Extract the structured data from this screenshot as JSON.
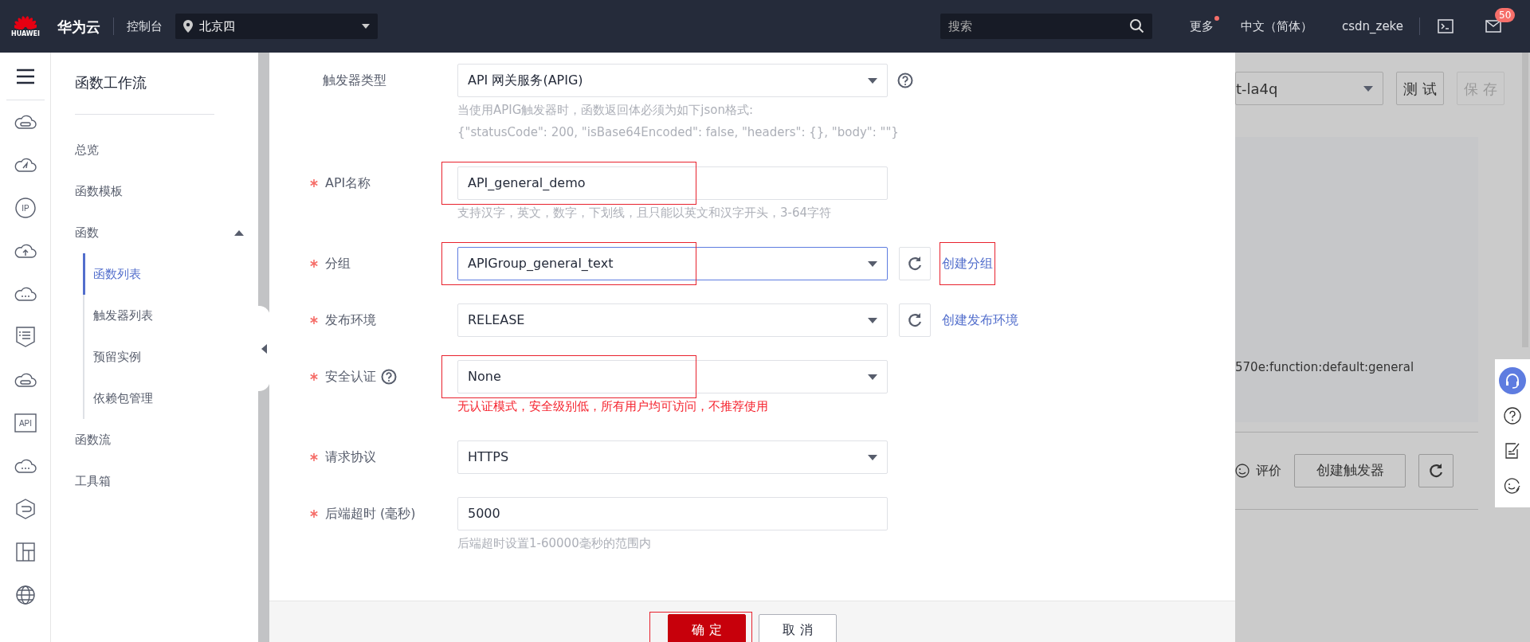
{
  "topbar": {
    "logo_caption": "HUAWEI",
    "brand": "华为云",
    "console": "控制台",
    "region": "北京四",
    "search_placeholder": "搜索",
    "more": "更多",
    "more_notice": true,
    "language": "中文（简体）",
    "user": "csdn_zeke",
    "mail_badge": "50"
  },
  "rail": [
    {
      "kind": "menu"
    },
    {
      "kind": "cloud-disk"
    },
    {
      "kind": "cloud-check"
    },
    {
      "kind": "ip",
      "label": "IP"
    },
    {
      "kind": "cloud-upload"
    },
    {
      "kind": "cloud-dots"
    },
    {
      "kind": "list-shield"
    },
    {
      "kind": "cloud-disk"
    },
    {
      "kind": "api",
      "label": "API"
    },
    {
      "kind": "cloud-dots"
    },
    {
      "kind": "hexagon"
    },
    {
      "kind": "layout"
    },
    {
      "kind": "globe"
    }
  ],
  "sidebar": {
    "title": "函数工作流",
    "items": [
      {
        "label": "总览",
        "selected": false
      },
      {
        "label": "函数模板",
        "selected": false
      },
      {
        "label": "函数",
        "selected": false,
        "expanded": true,
        "children": [
          {
            "label": "函数列表",
            "selected": true
          },
          {
            "label": "触发器列表",
            "selected": false
          },
          {
            "label": "预留实例",
            "selected": false
          },
          {
            "label": "依赖包管理",
            "selected": false
          }
        ]
      },
      {
        "label": "函数流",
        "selected": false
      },
      {
        "label": "工具箱",
        "selected": false
      }
    ]
  },
  "dialog": {
    "fields": [
      {
        "label": "触发器类型",
        "required": false,
        "kind": "select",
        "value": "API 网关服务(APIG)",
        "control_help": true,
        "highlighted": false,
        "hint_warning": false,
        "hint_lines": [
          "当使用APIG触发器时，函数返回体必须为如下json格式:",
          "{\"statusCode\": 200, \"isBase64Encoded\": false, \"headers\": {}, \"body\": \"\"}"
        ]
      },
      {
        "label": "API名称",
        "required": true,
        "kind": "input",
        "value": "API_general_demo",
        "highlighted": true,
        "hint_warning": false,
        "hint_lines": [
          "支持汉字，英文，数字，下划线，且只能以英文和汉字开头，3-64字符"
        ]
      },
      {
        "label": "分组",
        "required": true,
        "kind": "select",
        "value": "APIGroup_general_text",
        "focused": true,
        "highlighted": true,
        "refresh": true,
        "link": {
          "label": "创建分组",
          "highlighted": true
        }
      },
      {
        "label": "发布环境",
        "required": true,
        "kind": "select",
        "value": "RELEASE",
        "highlighted": false,
        "refresh": true,
        "link": {
          "label": "创建发布环境",
          "highlighted": false
        }
      },
      {
        "label": "安全认证",
        "required": true,
        "kind": "select",
        "value": "None",
        "label_help": true,
        "highlighted": true,
        "hint_warning": true,
        "hint_lines": [
          "无认证模式，安全级别低，所有用户均可访问，不推荐使用"
        ]
      },
      {
        "label": "请求协议",
        "required": true,
        "kind": "select",
        "value": "HTTPS",
        "highlighted": false
      },
      {
        "label": "后端超时 (毫秒)",
        "required": true,
        "kind": "input",
        "value": "5000",
        "highlighted": false,
        "hint_warning": false,
        "hint_lines": [
          "后端超时设置1-60000毫秒的范围内"
        ]
      }
    ],
    "buttons": [
      {
        "label": "确 定",
        "kind": "primary",
        "highlighted": true
      },
      {
        "label": "取 消",
        "kind": "default",
        "highlighted": false
      }
    ]
  },
  "background": {
    "version_select": "t-la4q",
    "buttons": [
      {
        "label": "测 试",
        "disabled": false
      },
      {
        "label": "保 存",
        "disabled": true
      }
    ],
    "urn_text": "570e:function:default:general",
    "rate_label": "评价",
    "create_trigger": "创建触发器"
  },
  "float_toolbar": [
    {
      "kind": "headset",
      "selected": true
    },
    {
      "kind": "help",
      "selected": false
    },
    {
      "kind": "note",
      "selected": false
    },
    {
      "kind": "smile",
      "selected": false
    }
  ]
}
